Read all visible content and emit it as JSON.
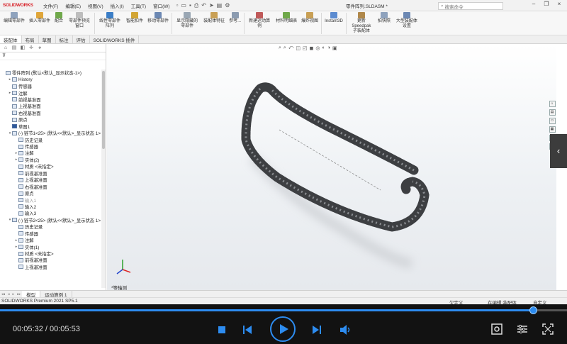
{
  "app": {
    "logo": "SOLIDWORKS",
    "menus": [
      "文件(F)",
      "编辑(E)",
      "视图(V)",
      "插入(I)",
      "工具(T)",
      "窗口(W)"
    ],
    "doc_title": "零件阵列.SLDASM *",
    "search_placeholder": "搜索命令"
  },
  "ribbon": {
    "buttons": [
      {
        "label": "编辑零部件",
        "icon": "edit-component-icon"
      },
      {
        "label": "插入零部件",
        "icon": "insert-component-icon"
      },
      {
        "label": "配合",
        "icon": "mate-icon"
      },
      {
        "label": "零部件预览窗口",
        "icon": "preview-window-icon"
      },
      {
        "label": "线性零部件阵列",
        "icon": "linear-pattern-icon"
      },
      {
        "label": "智能扣件",
        "icon": "smart-fastener-icon"
      },
      {
        "label": "移动零部件",
        "icon": "move-component-icon"
      },
      {
        "label": "显示隐藏的零部件",
        "icon": "show-hidden-icon"
      },
      {
        "label": "装配体特征",
        "icon": "assembly-feature-icon"
      },
      {
        "label": "参考...",
        "icon": "reference-icon"
      },
      {
        "label": "新建运动算例",
        "icon": "motion-study-icon"
      },
      {
        "label": "材料明细表",
        "icon": "bom-icon"
      },
      {
        "label": "爆炸视图",
        "icon": "explode-view-icon"
      },
      {
        "label": "Instant3D",
        "icon": "instant3d-icon"
      },
      {
        "label": "更新 Speedpak 子装配体",
        "icon": "speedpak-icon"
      },
      {
        "label": "拍快照",
        "icon": "snapshot-icon"
      },
      {
        "label": "大型装配体设置",
        "icon": "large-assembly-icon"
      }
    ]
  },
  "tabs": [
    "装配体",
    "布局",
    "草图",
    "标注",
    "评估",
    "SOLIDWORKS 插件"
  ],
  "tree": {
    "root": "零件阵列 (默认<默认_显示状态-1>)",
    "items": [
      {
        "label": "History",
        "indent": 1,
        "exp": "▸"
      },
      {
        "label": "传感器",
        "indent": 1,
        "exp": ""
      },
      {
        "label": "注解",
        "indent": 1,
        "exp": "▸"
      },
      {
        "label": "前视基准面",
        "indent": 1,
        "exp": ""
      },
      {
        "label": "上视基准面",
        "indent": 1,
        "exp": ""
      },
      {
        "label": "右视基准面",
        "indent": 1,
        "exp": ""
      },
      {
        "label": "原点",
        "indent": 1,
        "exp": ""
      },
      {
        "label": "草图1",
        "indent": 1,
        "exp": "",
        "sketch": true
      },
      {
        "label": "(-) 链节1<25> (默认<<默认>_显示状态 1>",
        "indent": 1,
        "exp": "▾"
      },
      {
        "label": "历史记录",
        "indent": 2,
        "exp": ""
      },
      {
        "label": "传感器",
        "indent": 2,
        "exp": ""
      },
      {
        "label": "注解",
        "indent": 2,
        "exp": "▸"
      },
      {
        "label": "实体(2)",
        "indent": 2,
        "exp": "▸"
      },
      {
        "label": "材质 <未指定>",
        "indent": 2,
        "exp": ""
      },
      {
        "label": "前视基准面",
        "indent": 2,
        "exp": ""
      },
      {
        "label": "上视基准面",
        "indent": 2,
        "exp": ""
      },
      {
        "label": "右视基准面",
        "indent": 2,
        "exp": ""
      },
      {
        "label": "原点",
        "indent": 2,
        "exp": ""
      },
      {
        "label": "输入1",
        "indent": 2,
        "exp": "",
        "faded": true
      },
      {
        "label": "输入2",
        "indent": 2,
        "exp": ""
      },
      {
        "label": "输入3",
        "indent": 2,
        "exp": ""
      },
      {
        "label": "(-) 链节2<25> (默认<<默认>_显示状态 1>",
        "indent": 1,
        "exp": "▾"
      },
      {
        "label": "历史记录",
        "indent": 2,
        "exp": ""
      },
      {
        "label": "传感器",
        "indent": 2,
        "exp": ""
      },
      {
        "label": "注解",
        "indent": 2,
        "exp": "▸"
      },
      {
        "label": "实体(1)",
        "indent": 2,
        "exp": "▸"
      },
      {
        "label": "材质 <未指定>",
        "indent": 2,
        "exp": ""
      },
      {
        "label": "前视基准面",
        "indent": 2,
        "exp": ""
      },
      {
        "label": "上视基准面",
        "indent": 2,
        "exp": ""
      }
    ]
  },
  "viewport": {
    "view_label": "*等轴测"
  },
  "bottom_tabs": [
    "模型",
    "运动算例 1"
  ],
  "status": {
    "version": "SOLIDWORKS Premium 2021 SP5.1",
    "s1": "欠定义",
    "s2": "在编辑 装配体",
    "s3": "自定义"
  },
  "player": {
    "time": "00:05:32 / 00:05:53",
    "progress": 0.94
  }
}
